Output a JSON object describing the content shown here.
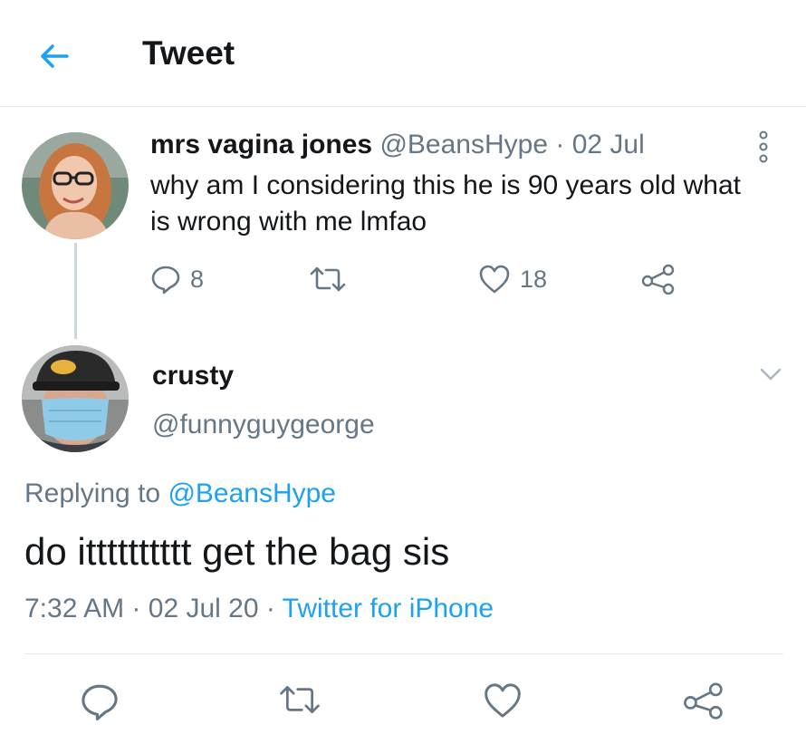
{
  "header": {
    "title": "Tweet"
  },
  "parent_tweet": {
    "display_name": "mrs vagina jones",
    "handle": "@BeansHype",
    "separator": "·",
    "date": "02 Jul",
    "text": "why am I considering this he is 90 years old what is wrong with me lmfao",
    "reply_count": "8",
    "retweet_count": "",
    "like_count": "18"
  },
  "reply_tweet": {
    "display_name": "crusty",
    "handle": "@funnyguygeorge",
    "replying_prefix": "Replying to",
    "replying_to": "@BeansHype",
    "text": "do itttttttttt get the bag sis",
    "time": "7:32 AM",
    "separator": "·",
    "date": "02 Jul 20",
    "source": "Twitter for iPhone"
  },
  "colors": {
    "accent": "#1da1f2",
    "secondary_text": "#657786",
    "primary_text": "#14171a",
    "divider": "#e6ecf0"
  },
  "icons": [
    "back-arrow-icon",
    "more-icon",
    "reply-icon",
    "retweet-icon",
    "like-icon",
    "share-icon",
    "chevron-down-icon"
  ]
}
